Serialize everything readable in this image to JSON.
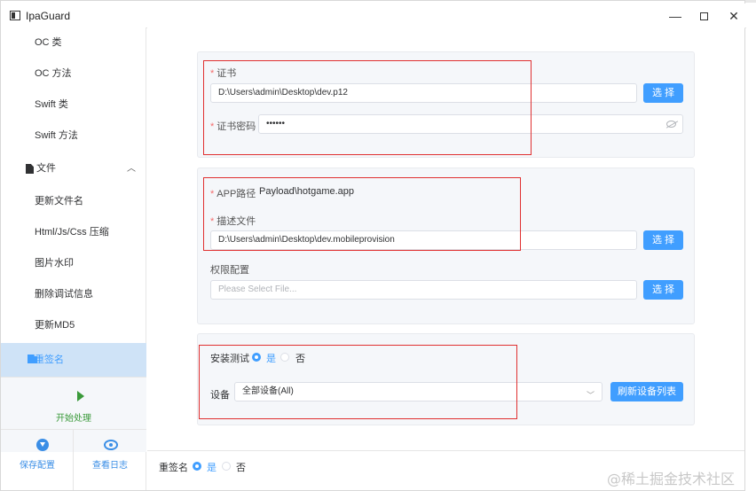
{
  "window": {
    "title": "IpaGuard",
    "minimize": "—",
    "close": "✕"
  },
  "sidebar": {
    "items": [
      {
        "label": "OC 类"
      },
      {
        "label": "OC 方法"
      },
      {
        "label": "Swift 类"
      },
      {
        "label": "Swift 方法"
      }
    ],
    "file_group": {
      "label": "文件",
      "icon": "file-icon",
      "chevron": "︿"
    },
    "file_items": [
      {
        "label": "更新文件名"
      },
      {
        "label": "Html/Js/Css 压缩"
      },
      {
        "label": "图片水印"
      },
      {
        "label": "删除调试信息"
      },
      {
        "label": "更新MD5"
      }
    ],
    "active_item": {
      "label": "重签名",
      "icon": "resign-icon"
    },
    "start": {
      "label": "开始处理",
      "icon": "play-icon"
    },
    "save": {
      "label": "保存配置",
      "icon": "download-icon"
    },
    "log": {
      "label": "查看日志",
      "icon": "eye-icon"
    }
  },
  "cert": {
    "label": "证书",
    "value": "D:\\Users\\admin\\Desktop\\dev.p12",
    "select_label": "选 择",
    "password_label": "证书密码",
    "password_value": "••••••"
  },
  "app": {
    "path_label": "APP路径",
    "path_value": "Payload\\hotgame.app",
    "profile_label": "描述文件",
    "profile_value": "D:\\Users\\admin\\Desktop\\dev.mobileprovision",
    "profile_select_label": "选 择",
    "entitlements_label": "权限配置",
    "entitlements_placeholder": "Please Select File...",
    "entitlements_select_label": "选 择"
  },
  "install": {
    "label": "安装测试",
    "yes": "是",
    "no": "否",
    "selected": "是",
    "device_label": "设备",
    "device_value": "全部设备(All)",
    "refresh_label": "刷新设备列表"
  },
  "footer": {
    "label": "重签名",
    "yes": "是",
    "no": "否",
    "selected": "是"
  },
  "watermark": "@稀土掘金技术社区",
  "colors": {
    "accent": "#409eff",
    "required": "#f56c6c",
    "start": "#3a9a3a",
    "highlight_box": "#e03030"
  }
}
